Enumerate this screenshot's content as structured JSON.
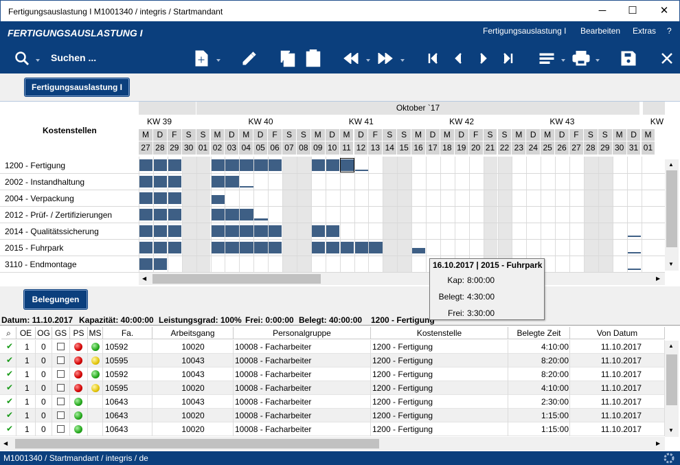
{
  "window": {
    "title": "Fertigungsauslastung I  M1001340 / integris / Startmandant",
    "minimize": "─",
    "maximize": "☐",
    "close": "✕"
  },
  "menubar": {
    "app_title": "FERTIGUNGSAUSLASTUNG I",
    "items": [
      {
        "label": "Fertigungsauslastung I"
      },
      {
        "label": "Bearbeiten"
      },
      {
        "label": "Extras"
      },
      {
        "label": "?"
      }
    ]
  },
  "toolbar": {
    "search_label": "Suchen ..."
  },
  "tabs": {
    "section1_button": "Fertigungsauslastung I",
    "section2_button": "Belegungen"
  },
  "gantt": {
    "header_label": "Kostenstellen",
    "month_label": "Oktober `17",
    "weeks": [
      {
        "label": "KW 39"
      },
      {
        "label": "KW 40"
      },
      {
        "label": "KW 41"
      },
      {
        "label": "KW 42"
      },
      {
        "label": "KW 43"
      },
      {
        "label": "KW"
      }
    ],
    "days": [
      {
        "wd": "M",
        "d": "27",
        "we": false
      },
      {
        "wd": "D",
        "d": "28",
        "we": false
      },
      {
        "wd": "F",
        "d": "29",
        "we": false
      },
      {
        "wd": "S",
        "d": "30",
        "we": true
      },
      {
        "wd": "S",
        "d": "01",
        "we": true
      },
      {
        "wd": "M",
        "d": "02",
        "we": false
      },
      {
        "wd": "D",
        "d": "03",
        "we": false
      },
      {
        "wd": "M",
        "d": "04",
        "we": false
      },
      {
        "wd": "D",
        "d": "05",
        "we": false
      },
      {
        "wd": "F",
        "d": "06",
        "we": false
      },
      {
        "wd": "S",
        "d": "07",
        "we": true
      },
      {
        "wd": "S",
        "d": "08",
        "we": true
      },
      {
        "wd": "M",
        "d": "09",
        "we": false
      },
      {
        "wd": "D",
        "d": "10",
        "we": false
      },
      {
        "wd": "M",
        "d": "11",
        "we": false
      },
      {
        "wd": "D",
        "d": "12",
        "we": false
      },
      {
        "wd": "F",
        "d": "13",
        "we": false
      },
      {
        "wd": "S",
        "d": "14",
        "we": true
      },
      {
        "wd": "S",
        "d": "15",
        "we": true
      },
      {
        "wd": "M",
        "d": "16",
        "we": false
      },
      {
        "wd": "D",
        "d": "17",
        "we": false
      },
      {
        "wd": "M",
        "d": "18",
        "we": false
      },
      {
        "wd": "D",
        "d": "19",
        "we": false
      },
      {
        "wd": "F",
        "d": "20",
        "we": false
      },
      {
        "wd": "S",
        "d": "21",
        "we": true
      },
      {
        "wd": "S",
        "d": "22",
        "we": true
      },
      {
        "wd": "M",
        "d": "23",
        "we": false
      },
      {
        "wd": "D",
        "d": "24",
        "we": false
      },
      {
        "wd": "M",
        "d": "25",
        "we": false
      },
      {
        "wd": "D",
        "d": "26",
        "we": false
      },
      {
        "wd": "F",
        "d": "27",
        "we": false
      },
      {
        "wd": "S",
        "d": "28",
        "we": true
      },
      {
        "wd": "S",
        "d": "29",
        "we": true
      },
      {
        "wd": "M",
        "d": "30",
        "we": false
      },
      {
        "wd": "D",
        "d": "31",
        "we": false
      },
      {
        "wd": "M",
        "d": "01",
        "we": false
      }
    ],
    "rows": [
      {
        "label": "1200 - Fertigung",
        "load": {
          "0": 1,
          "1": 1,
          "2": 1,
          "5": 1,
          "6": 1,
          "7": 1,
          "8": 1,
          "9": 1,
          "12": 1,
          "13": 1,
          "14": 1,
          "15": 0.1
        }
      },
      {
        "label": "2002 - Instandhaltung",
        "load": {
          "0": 1,
          "1": 1,
          "2": 1,
          "5": 1,
          "6": 1,
          "7": 0.1
        }
      },
      {
        "label": "2004 - Verpackung",
        "load": {
          "0": 1,
          "1": 1,
          "2": 1,
          "5": 0.75
        }
      },
      {
        "label": "2012 - Prüf- / Zertifizierungen",
        "load": {
          "0": 1,
          "1": 1,
          "2": 1,
          "5": 1,
          "6": 1,
          "7": 1,
          "8": 0.2
        }
      },
      {
        "label": "2014 - Qualitätssicherung",
        "load": {
          "0": 1,
          "1": 1,
          "2": 1,
          "5": 1,
          "6": 1,
          "7": 1,
          "8": 1,
          "9": 1,
          "12": 1,
          "13": 1,
          "34": 0.1
        }
      },
      {
        "label": "2015 - Fuhrpark",
        "load": {
          "0": 1,
          "1": 1,
          "2": 1,
          "5": 1,
          "6": 1,
          "7": 1,
          "8": 1,
          "9": 1,
          "12": 1,
          "13": 1,
          "14": 1,
          "15": 1,
          "16": 1,
          "19": 0.5,
          "34": 0.1
        }
      },
      {
        "label": "3110 - Endmontage",
        "load": {
          "0": 1,
          "1": 1,
          "34": 0.1
        }
      }
    ]
  },
  "tooltip": {
    "header": "16.10.2017 | 2015 - Fuhrpark",
    "lines": [
      {
        "k": "Kap:",
        "v": "8:00:00"
      },
      {
        "k": "Belegt:",
        "v": "4:30:00"
      },
      {
        "k": "Frei:",
        "v": "3:30:00"
      }
    ]
  },
  "info": {
    "datum": "Datum: 11.10.2017",
    "kapazitaet": "Kapazität: 40:00:00",
    "leistungsgrad": "Leistungsgrad: 100%",
    "frei": "Frei: 0:00:00",
    "belegt": "Belegt: 40:00:00",
    "kst": "1200 - Fertigung"
  },
  "table": {
    "columns": [
      {
        "label": "⌕"
      },
      {
        "label": "OE"
      },
      {
        "label": "OG"
      },
      {
        "label": "GS"
      },
      {
        "label": "PS"
      },
      {
        "label": "MS"
      },
      {
        "label": "Fa."
      },
      {
        "label": "Arbeitsgang"
      },
      {
        "label": "Personalgruppe"
      },
      {
        "label": "Kostenstelle"
      },
      {
        "label": "Belegte Zeit"
      },
      {
        "label": "Von Datum"
      }
    ],
    "rows": [
      {
        "check": "✔",
        "oe": "1",
        "og": "0",
        "ps": "red",
        "ms": "green",
        "fa": "10592",
        "ag": "10020",
        "pg": "10008 - Facharbeiter",
        "ks": "1200 - Fertigung",
        "zeit": "4:10:00",
        "datum": "11.10.2017"
      },
      {
        "check": "✔",
        "oe": "1",
        "og": "0",
        "ps": "red",
        "ms": "yellow",
        "fa": "10595",
        "ag": "10043",
        "pg": "10008 - Facharbeiter",
        "ks": "1200 - Fertigung",
        "zeit": "8:20:00",
        "datum": "11.10.2017"
      },
      {
        "check": "✔",
        "oe": "1",
        "og": "0",
        "ps": "red",
        "ms": "green",
        "fa": "10592",
        "ag": "10043",
        "pg": "10008 - Facharbeiter",
        "ks": "1200 - Fertigung",
        "zeit": "8:20:00",
        "datum": "11.10.2017"
      },
      {
        "check": "✔",
        "oe": "1",
        "og": "0",
        "ps": "red",
        "ms": "yellow",
        "fa": "10595",
        "ag": "10020",
        "pg": "10008 - Facharbeiter",
        "ks": "1200 - Fertigung",
        "zeit": "4:10:00",
        "datum": "11.10.2017"
      },
      {
        "check": "✔",
        "oe": "1",
        "og": "0",
        "ps": "green",
        "ms": "",
        "fa": "10643",
        "ag": "10043",
        "pg": "10008 - Facharbeiter",
        "ks": "1200 - Fertigung",
        "zeit": "2:30:00",
        "datum": "11.10.2017"
      },
      {
        "check": "✔",
        "oe": "1",
        "og": "0",
        "ps": "green",
        "ms": "",
        "fa": "10643",
        "ag": "10020",
        "pg": "10008 - Facharbeiter",
        "ks": "1200 - Fertigung",
        "zeit": "1:15:00",
        "datum": "11.10.2017"
      },
      {
        "check": "✔",
        "oe": "1",
        "og": "0",
        "ps": "green",
        "ms": "",
        "fa": "10643",
        "ag": "10020",
        "pg": "10008 - Facharbeiter",
        "ks": "1200 - Fertigung",
        "zeit": "1:15:00",
        "datum": "11.10.2017"
      }
    ]
  },
  "statusbar": {
    "text": "M1001340 / Startmandant / integris / de"
  },
  "colors": {
    "accent": "#0b3f7d",
    "bar": "#3e5f85",
    "weekend": "#e6e6e6"
  }
}
